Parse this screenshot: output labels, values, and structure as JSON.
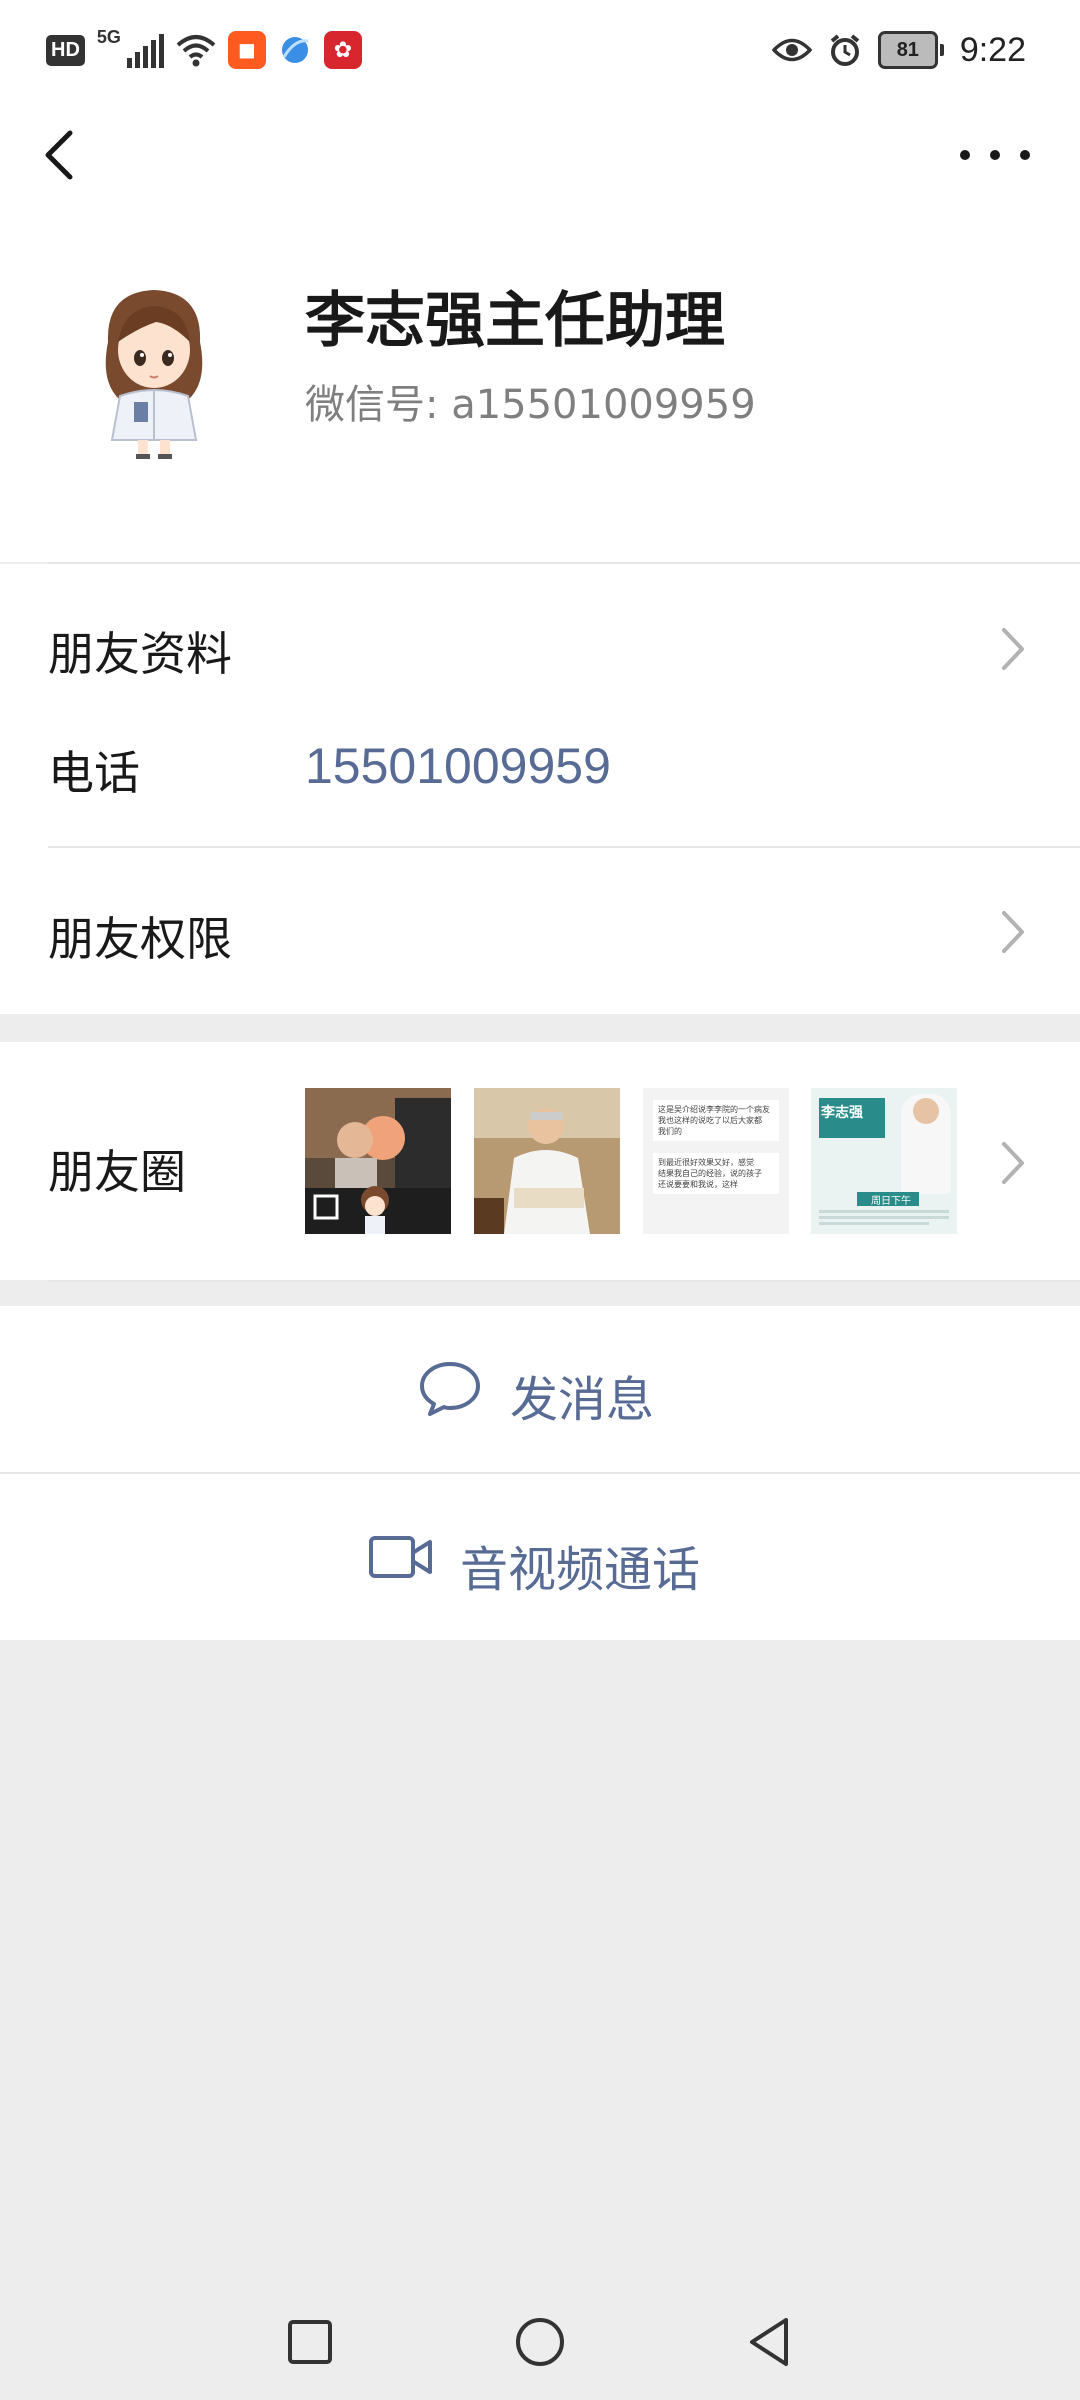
{
  "status_bar": {
    "left": {
      "hd": "HD",
      "network": "5G"
    },
    "battery": "81",
    "time": "9:22"
  },
  "contact": {
    "name": "李志强主任助理",
    "wechat_id": "微信号: a15501009959"
  },
  "rows": {
    "friend_info": "朋友资料",
    "phone_label": "电话",
    "phone_value": "15501009959",
    "permissions": "朋友权限",
    "moments": "朋友圈"
  },
  "moments_thumbs": {
    "thumb3_lines": [
      "这是吴介绍说李李院的一个病友",
      "我也这样的说吃了以后大家都",
      "我们的",
      "到最近很好效果又好，感觉",
      "结果我自己的经验，说的孩子",
      "还说要要和我说，这样"
    ],
    "thumb4_title": "李志强",
    "thumb4_subtitle": "周日下午"
  },
  "actions": {
    "message": "发消息",
    "video_call": "音视频通话"
  },
  "colors": {
    "link": "#576b95",
    "page_bg": "#ededed",
    "card_bg": "#ffffff"
  },
  "icons": [
    "back-arrow-icon",
    "more-dots-icon",
    "chevron-right-icon",
    "chat-bubble-icon",
    "video-camera-icon",
    "nav-square-icon",
    "nav-circle-icon",
    "nav-triangle-icon"
  ]
}
